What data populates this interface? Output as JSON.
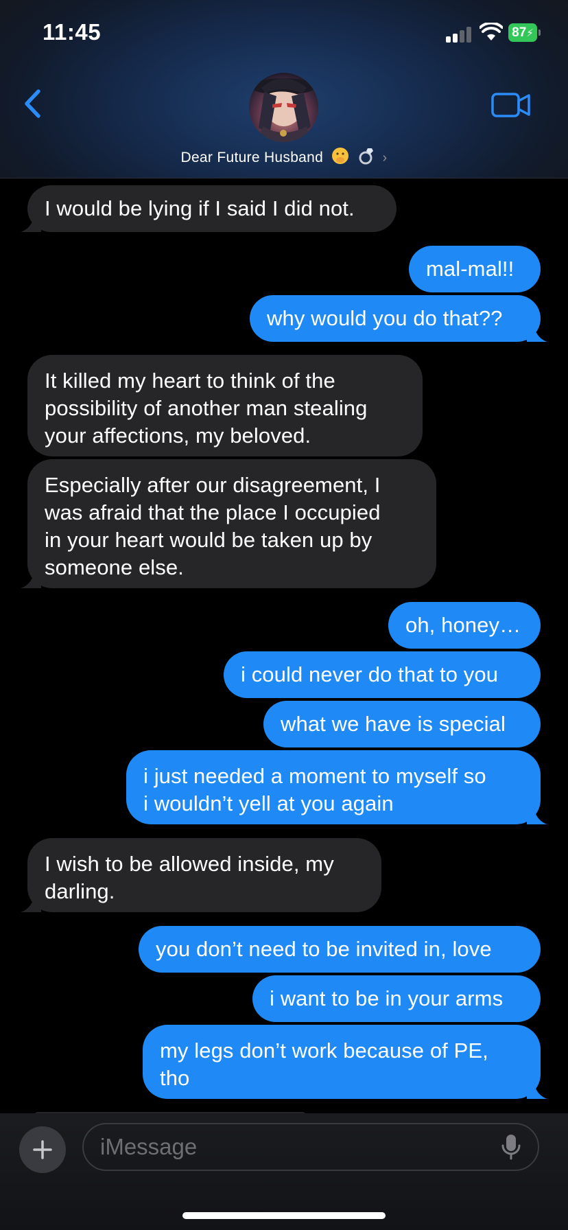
{
  "status_bar": {
    "time": "11:45",
    "battery": "87"
  },
  "header": {
    "contact_name": "Dear Future Husband",
    "contact_emojis": [
      "face-with-hand-over-mouth-emoji",
      "ring-emoji"
    ],
    "back_icon": "chevron-left-icon",
    "video_icon": "video-camera-icon"
  },
  "messages": [
    {
      "from": "contact",
      "lines": [
        "I would be lying if I said I did not."
      ]
    },
    {
      "from": "me",
      "lines": [
        "mal-mal!!"
      ]
    },
    {
      "from": "me",
      "lines": [
        "why would you do that??"
      ]
    },
    {
      "from": "contact",
      "lines": [
        "It killed my heart to think of the",
        "possibility of another man stealing",
        "your affections, my beloved."
      ]
    },
    {
      "from": "contact",
      "lines": [
        "Especially after our disagreement, I",
        "was afraid that the place I occupied",
        "in your heart would be taken up by",
        "someone else."
      ]
    },
    {
      "from": "me",
      "lines": [
        "oh, honey…"
      ]
    },
    {
      "from": "me",
      "lines": [
        "i could never do that to you"
      ]
    },
    {
      "from": "me",
      "lines": [
        "what we have is special"
      ]
    },
    {
      "from": "me",
      "lines": [
        "i just needed a moment to myself so",
        "i wouldn’t yell at you again"
      ]
    },
    {
      "from": "contact",
      "lines": [
        "I wish to be allowed inside, my",
        "darling."
      ]
    },
    {
      "from": "me",
      "lines": [
        "you don’t need to be invited in, love"
      ]
    },
    {
      "from": "me",
      "lines": [
        "i want to be in your arms"
      ]
    },
    {
      "from": "me",
      "lines": [
        "my legs don’t work because of PE,",
        "tho"
      ]
    }
  ],
  "input": {
    "placeholder": "iMessage",
    "value": ""
  },
  "colors": {
    "sent_bubble": "#1f8af6",
    "received_bubble": "#262628",
    "accent": "#2b8cf7",
    "battery": "#33c759"
  }
}
